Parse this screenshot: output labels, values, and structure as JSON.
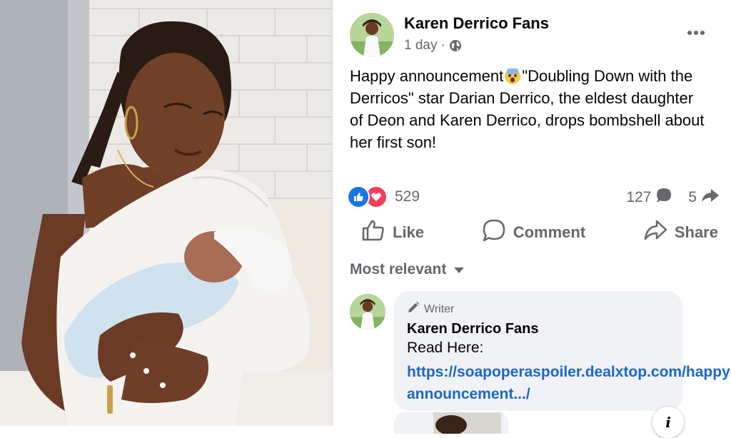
{
  "post": {
    "page_name": "Karen Derrico Fans",
    "time": "1 day",
    "separator": "·",
    "privacy_icon": "globe-icon",
    "more_icon": "more-horizontal-icon",
    "text_part1": "Happy announcement",
    "emoji": "shocked-face-emoji",
    "text_part2": "\"Doubling Down with the Derricos\" star Darian Derrico, the eldest daughter of Deon and Karen Derrico, drops bombshell about her first son!"
  },
  "stats": {
    "reaction_icons": [
      "like-icon",
      "love-icon"
    ],
    "reactions_count": "529",
    "comments_count": "127",
    "shares_count": "5"
  },
  "actions": {
    "like_label": "Like",
    "comment_label": "Comment",
    "share_label": "Share"
  },
  "comments": {
    "sort_label": "Most relevant",
    "first": {
      "badge": "Writer",
      "author": "Karen Derrico Fans",
      "line1": "Read Here:",
      "link": "https://soapoperaspoiler.dealxtop.com/happy-announcement.../"
    }
  },
  "colors": {
    "accent_blue": "#1b74e4",
    "love_red": "#f33e58",
    "text_secondary": "#65676b",
    "link": "#1d66c9",
    "bubble_bg": "#f0f2f5"
  }
}
